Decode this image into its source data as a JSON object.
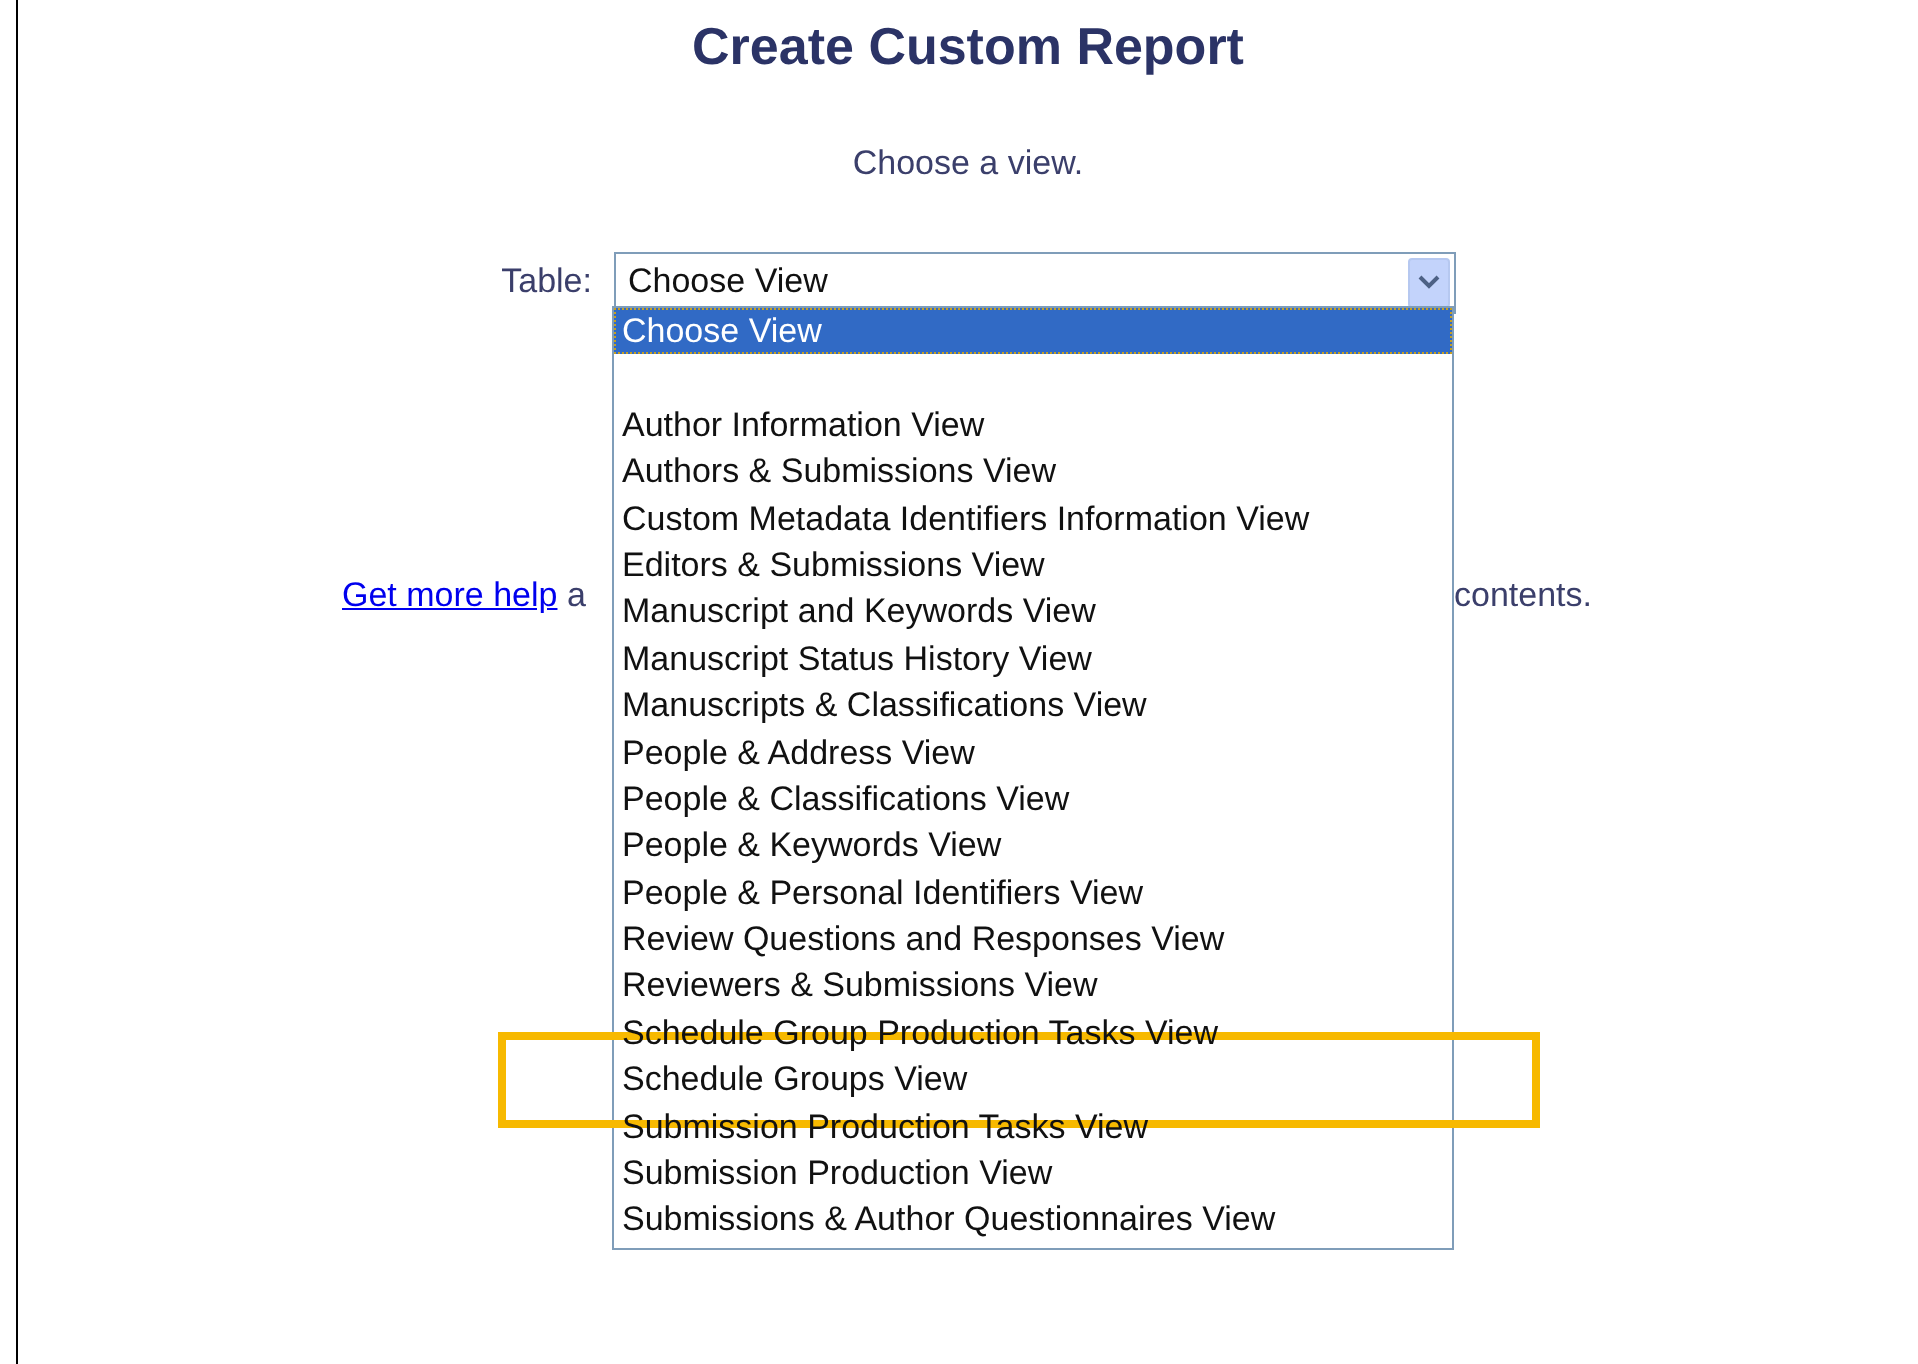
{
  "title": "Create Custom Report",
  "instruction": "Choose a view.",
  "table_field": {
    "label": "Table:",
    "value": "Choose View",
    "expanded": true
  },
  "options": [
    {
      "label": "Choose View",
      "selected": true,
      "highlighted": false
    },
    {
      "kind": "blank"
    },
    {
      "label": "Author Information View",
      "selected": false,
      "highlighted": false
    },
    {
      "label": "Authors & Submissions View",
      "selected": false,
      "highlighted": false
    },
    {
      "label": "Custom Metadata Identifiers Information View",
      "selected": false,
      "highlighted": false
    },
    {
      "label": "Editors & Submissions View",
      "selected": false,
      "highlighted": false
    },
    {
      "label": "Manuscript and Keywords View",
      "selected": false,
      "highlighted": false
    },
    {
      "label": "Manuscript Status History View",
      "selected": false,
      "highlighted": false
    },
    {
      "label": "Manuscripts & Classifications View",
      "selected": false,
      "highlighted": false
    },
    {
      "label": "People & Address View",
      "selected": false,
      "highlighted": false
    },
    {
      "label": "People & Classifications View",
      "selected": false,
      "highlighted": false
    },
    {
      "label": "People & Keywords View",
      "selected": false,
      "highlighted": false
    },
    {
      "label": "People & Personal Identifiers View",
      "selected": false,
      "highlighted": false
    },
    {
      "label": "Review Questions and Responses View",
      "selected": false,
      "highlighted": false
    },
    {
      "label": "Reviewers & Submissions View",
      "selected": false,
      "highlighted": false
    },
    {
      "label": "Schedule Group Production Tasks View",
      "selected": false,
      "highlighted": false
    },
    {
      "label": "Schedule Groups View",
      "selected": false,
      "highlighted": true
    },
    {
      "label": "Submission Production Tasks View",
      "selected": false,
      "highlighted": false
    },
    {
      "label": "Submission Production View",
      "selected": false,
      "highlighted": false
    },
    {
      "label": "Submissions & Author Questionnaires View",
      "selected": false,
      "highlighted": false
    }
  ],
  "help_line": {
    "link": "Get more help",
    "text_start": "a",
    "text_end": "contents."
  }
}
